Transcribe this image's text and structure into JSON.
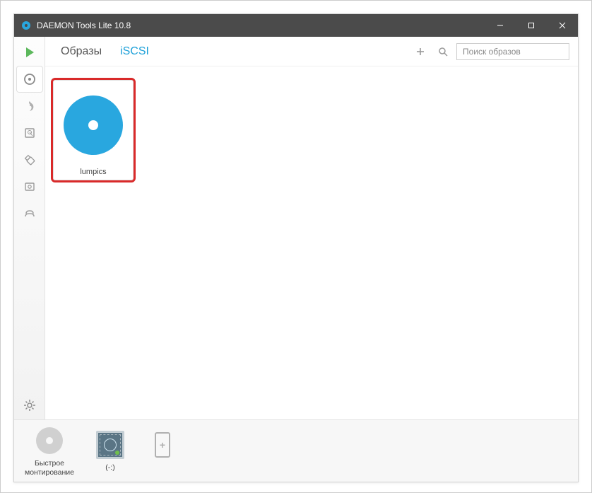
{
  "window": {
    "title": "DAEMON Tools Lite 10.8"
  },
  "tabs": {
    "images": "Образы",
    "iscsi": "iSCSI"
  },
  "toolbar": {
    "search_placeholder": "Поиск образов"
  },
  "catalog": {
    "items": [
      {
        "label": "lumpics"
      }
    ]
  },
  "bottombar": {
    "quick_mount": "Быстрое монтирование",
    "drive_label": "(-:)"
  }
}
